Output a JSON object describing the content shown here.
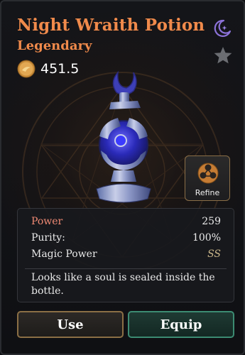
{
  "item": {
    "name": "Night Wraith Potion",
    "rarity": "Legendary",
    "price": "451.5"
  },
  "icons": {
    "currency": "gold-coin-icon",
    "category": "moon-star-icon",
    "favorite": "star-icon",
    "refine": "orbs-icon"
  },
  "refine": {
    "label": "Refine"
  },
  "stats": [
    {
      "label": "Power",
      "value": "259",
      "highlight": true
    },
    {
      "label": "Purity:",
      "value": "100%"
    },
    {
      "label": "Magic Power",
      "value": "SS"
    }
  ],
  "description": "Looks like a soul is sealed inside the bottle.",
  "actions": {
    "use": "Use",
    "equip": "Equip"
  },
  "colors": {
    "title": "#f08a4b",
    "accent_equip": "#3c8b72",
    "accent_use": "#8b6f45",
    "potion_blue": "#3a3ad0"
  }
}
